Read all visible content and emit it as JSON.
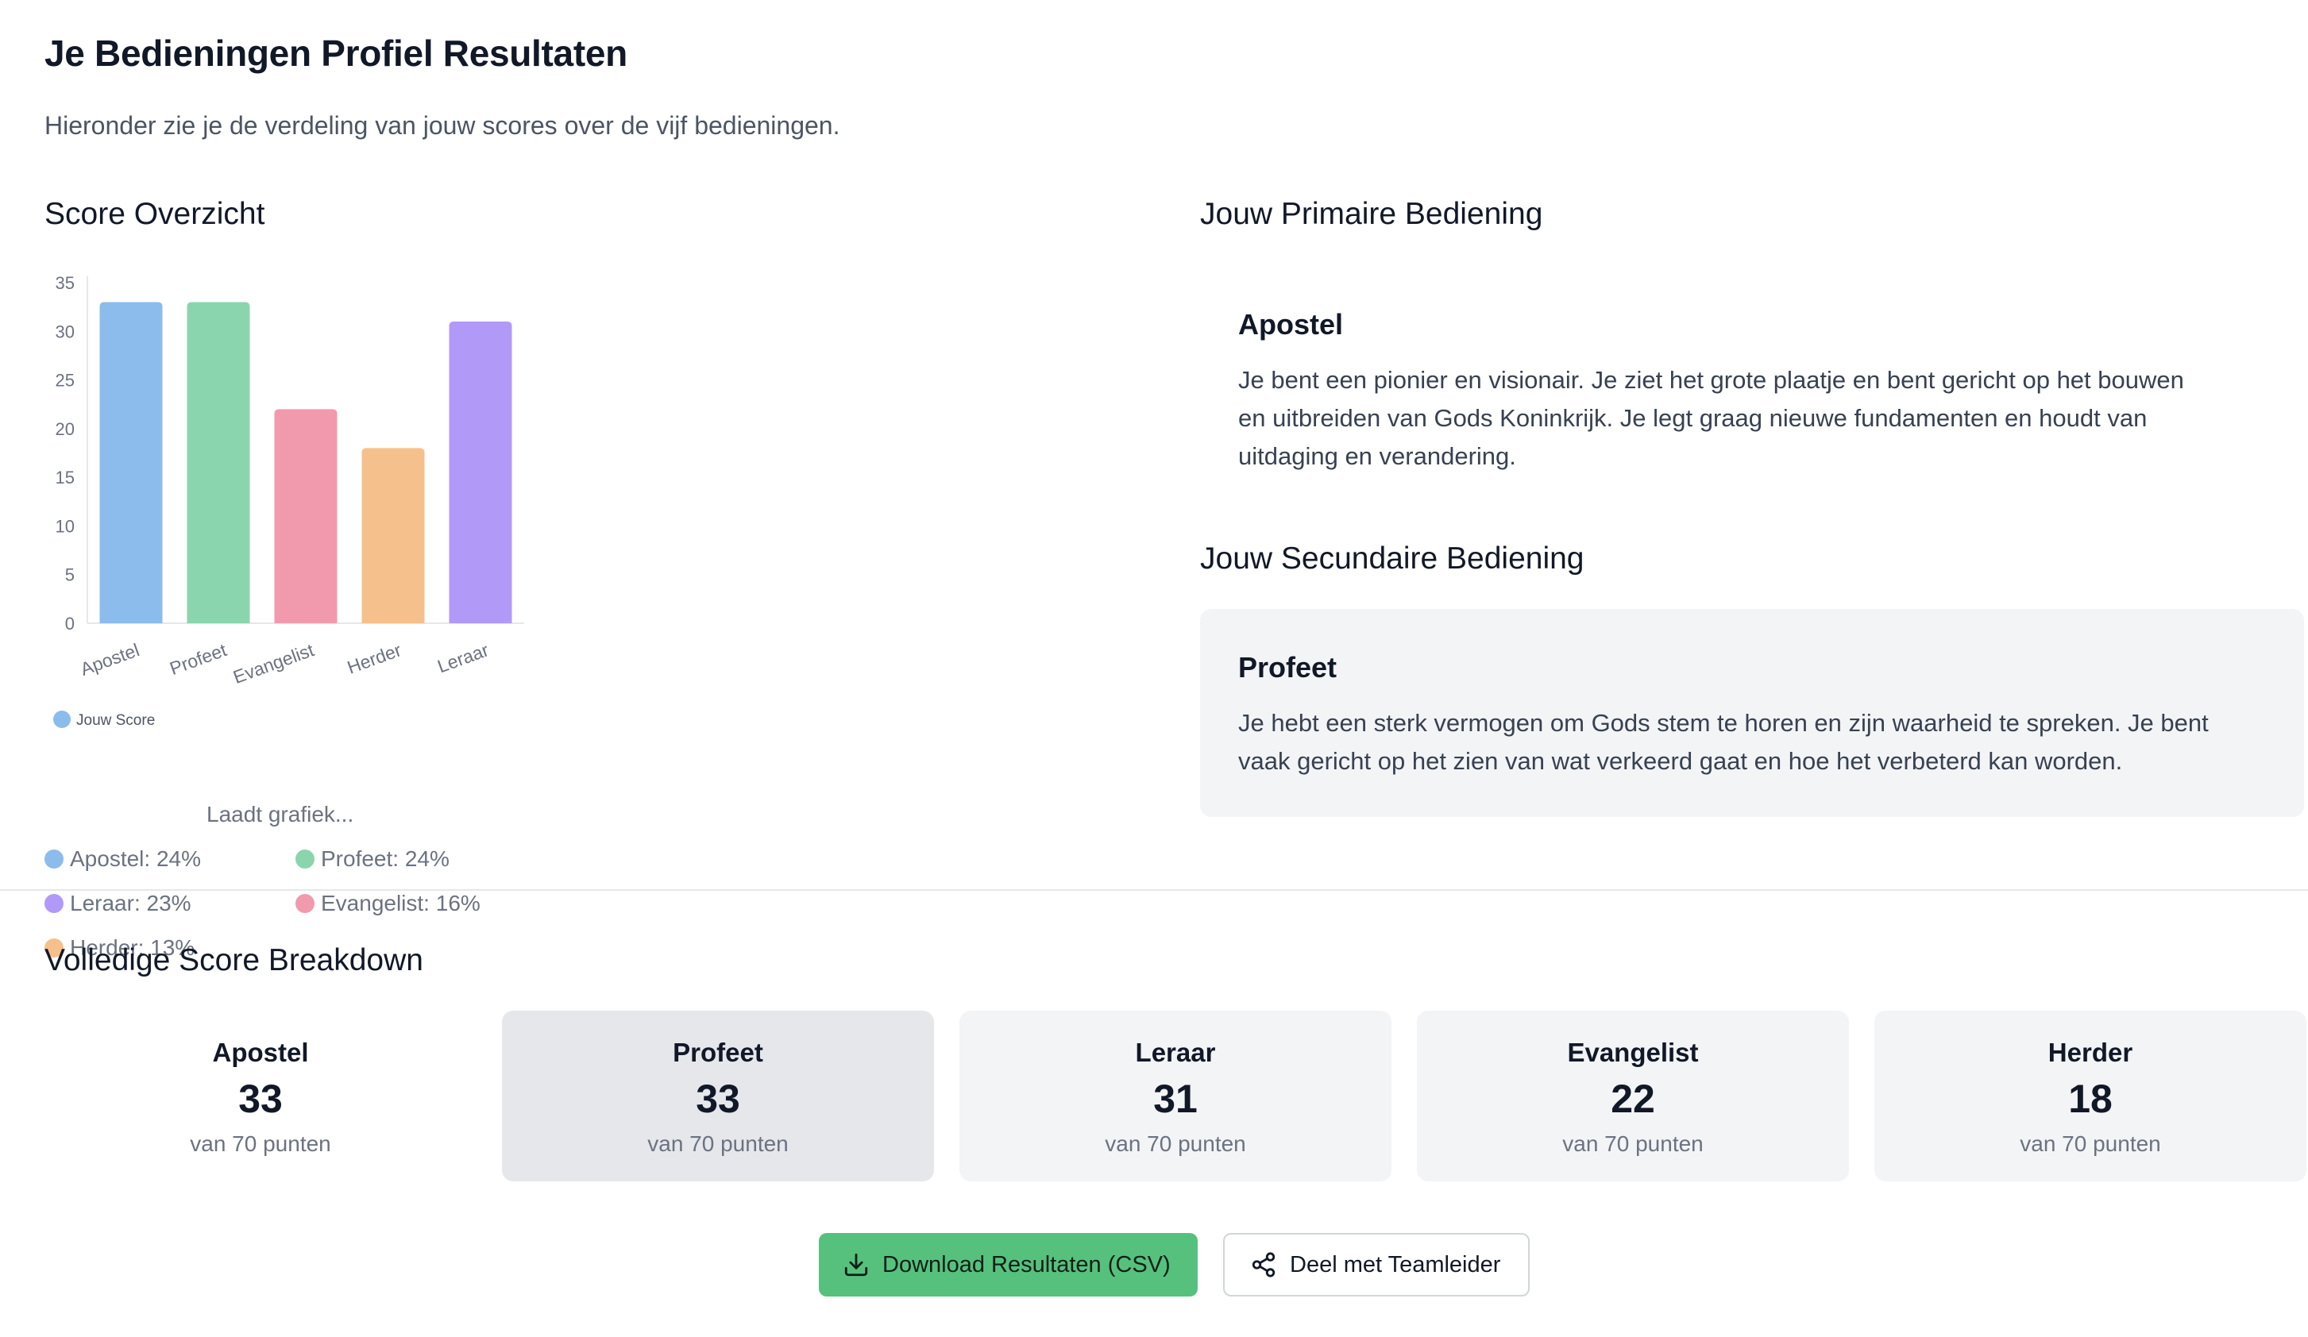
{
  "page": {
    "title": "Je Bedieningen Profiel Resultaten",
    "subtitle": "Hieronder zie je de verdeling van jouw scores over de vijf bedieningen."
  },
  "overview": {
    "heading": "Score Overzicht",
    "loading_text": "Laadt grafiek...",
    "percentages": [
      {
        "label": "Apostel: 24%",
        "color": "#8bbcec"
      },
      {
        "label": "Profeet: 24%",
        "color": "#8bd5ae"
      },
      {
        "label": "Leraar: 23%",
        "color": "#b199f7"
      },
      {
        "label": "Evangelist: 16%",
        "color": "#f29aad"
      },
      {
        "label": "Herder: 13%",
        "color": "#f6c08c"
      }
    ]
  },
  "chart_data": {
    "type": "bar",
    "categories": [
      "Apostel",
      "Profeet",
      "Evangelist",
      "Herder",
      "Leraar"
    ],
    "series": [
      {
        "name": "Jouw Score",
        "values": [
          33,
          33,
          22,
          18,
          31
        ]
      }
    ],
    "colors": [
      "#8bbcec",
      "#8bd5ae",
      "#f29aad",
      "#f6c08c",
      "#b199f7"
    ],
    "ylim": [
      0,
      35
    ],
    "yticks": [
      0,
      5,
      10,
      15,
      20,
      25,
      30,
      35
    ],
    "legend": "bottom-left",
    "grid": false
  },
  "primary": {
    "heading": "Jouw Primaire Bediening",
    "name": "Apostel",
    "description_lines": [
      "Je bent een pionier en visionair. Je ziet het grote plaatje en bent gericht op het bouwen",
      "en uitbreiden van Gods Koninkrijk. Je legt graag nieuwe fundamenten en houdt van",
      "uitdaging en verandering."
    ]
  },
  "secondary": {
    "heading": "Jouw Secundaire Bediening",
    "name": "Profeet",
    "description_lines": [
      "Je hebt een sterk vermogen om Gods stem te horen en zijn waarheid te spreken. Je bent",
      "vaak gericht op het zien van wat verkeerd gaat en hoe het verbeterd kan worden."
    ]
  },
  "breakdown": {
    "heading": "Volledige Score Breakdown",
    "cards": [
      {
        "name": "Apostel",
        "score": "33",
        "sub": "van 70 punten"
      },
      {
        "name": "Profeet",
        "score": "33",
        "sub": "van 70 punten"
      },
      {
        "name": "Leraar",
        "score": "31",
        "sub": "van 70 punten"
      },
      {
        "name": "Evangelist",
        "score": "22",
        "sub": "van 70 punten"
      },
      {
        "name": "Herder",
        "score": "18",
        "sub": "van 70 punten"
      }
    ]
  },
  "actions": {
    "download_label": "Download Resultaten (CSV)",
    "download_icon": "download-icon",
    "share_label": "Deel met Teamleider",
    "share_icon": "share-icon"
  }
}
